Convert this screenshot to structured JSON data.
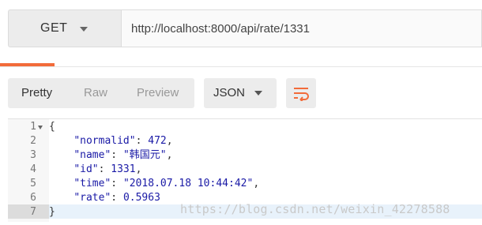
{
  "request": {
    "method": "GET",
    "url": "http://localhost:8000/api/rate/1331"
  },
  "toolbar": {
    "views": [
      "Pretty",
      "Raw",
      "Preview"
    ],
    "active_view": "Pretty",
    "format": "JSON",
    "wrap_icon": "wrap-lines-icon"
  },
  "editor": {
    "lines": [
      {
        "num": "1",
        "tokens": [
          {
            "t": "{",
            "c": "brace"
          }
        ]
      },
      {
        "num": "2",
        "tokens": [
          {
            "t": "    ",
            "c": "pun"
          },
          {
            "t": "\"normalid\"",
            "c": "key"
          },
          {
            "t": ": ",
            "c": "pun"
          },
          {
            "t": "472",
            "c": "num"
          },
          {
            "t": ",",
            "c": "pun"
          }
        ]
      },
      {
        "num": "3",
        "tokens": [
          {
            "t": "    ",
            "c": "pun"
          },
          {
            "t": "\"name\"",
            "c": "key"
          },
          {
            "t": ": ",
            "c": "pun"
          },
          {
            "t": "\"韩国元\"",
            "c": "str"
          },
          {
            "t": ",",
            "c": "pun"
          }
        ]
      },
      {
        "num": "4",
        "tokens": [
          {
            "t": "    ",
            "c": "pun"
          },
          {
            "t": "\"id\"",
            "c": "key"
          },
          {
            "t": ": ",
            "c": "pun"
          },
          {
            "t": "1331",
            "c": "num"
          },
          {
            "t": ",",
            "c": "pun"
          }
        ]
      },
      {
        "num": "5",
        "tokens": [
          {
            "t": "    ",
            "c": "pun"
          },
          {
            "t": "\"time\"",
            "c": "key"
          },
          {
            "t": ": ",
            "c": "pun"
          },
          {
            "t": "\"2018.07.18 10:44:42\"",
            "c": "str"
          },
          {
            "t": ",",
            "c": "pun"
          }
        ]
      },
      {
        "num": "6",
        "tokens": [
          {
            "t": "    ",
            "c": "pun"
          },
          {
            "t": "\"rate\"",
            "c": "key"
          },
          {
            "t": ": ",
            "c": "pun"
          },
          {
            "t": "0.5963",
            "c": "num"
          }
        ]
      },
      {
        "num": "7",
        "tokens": [
          {
            "t": "}",
            "c": "brace"
          }
        ]
      }
    ]
  },
  "watermark": "https://blog.csdn.net/weixin_42278588",
  "colors": {
    "accent": "#f26b3a",
    "json_value": "#1a1aa6"
  }
}
